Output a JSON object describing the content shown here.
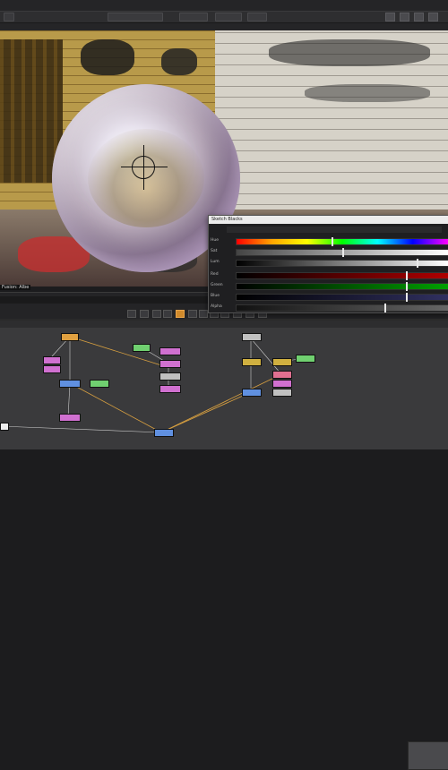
{
  "viewer": {
    "label": "Fusion: Albe"
  },
  "color_panel": {
    "title": "Sketch Blacks",
    "rows": [
      {
        "label": "Hue",
        "value": 0.45
      },
      {
        "label": "Sat",
        "value": 0.5
      },
      {
        "label": "Lum",
        "value": 0.85
      },
      {
        "label": "Red",
        "value": 0.8
      },
      {
        "label": "Green",
        "value": 0.8
      },
      {
        "label": "Blue",
        "value": 0.8
      },
      {
        "label": "Alpha",
        "value": 0.7
      }
    ]
  },
  "colors": {
    "accent_orange": "#d08a2b",
    "panel_bg": "#1f1f21",
    "node_bg": "#3a3a3c"
  },
  "node_graph": {
    "nodes": [
      {
        "id": "n1",
        "color": "#e0a040"
      },
      {
        "id": "n2",
        "color": "#d070d0"
      },
      {
        "id": "n3",
        "color": "#d070d0"
      },
      {
        "id": "n4",
        "color": "#6090e0"
      },
      {
        "id": "n5",
        "color": "#70d070"
      },
      {
        "id": "n6",
        "color": "#70d070"
      },
      {
        "id": "n7",
        "color": "#d070d0"
      },
      {
        "id": "n8",
        "color": "#d070d0"
      },
      {
        "id": "n9",
        "color": "#c0c0c0"
      },
      {
        "id": "n10",
        "color": "#d070d0"
      },
      {
        "id": "n11",
        "color": "#d0b040"
      },
      {
        "id": "n12",
        "color": "#6090e0"
      },
      {
        "id": "n13",
        "color": "#70d070"
      },
      {
        "id": "n14",
        "color": "#e07090"
      },
      {
        "id": "n15",
        "color": "#d070d0"
      },
      {
        "id": "n16",
        "color": "#6090e0"
      },
      {
        "id": "n17",
        "color": "#c0c0c0"
      },
      {
        "id": "n18",
        "color": "#d0b040"
      }
    ]
  }
}
